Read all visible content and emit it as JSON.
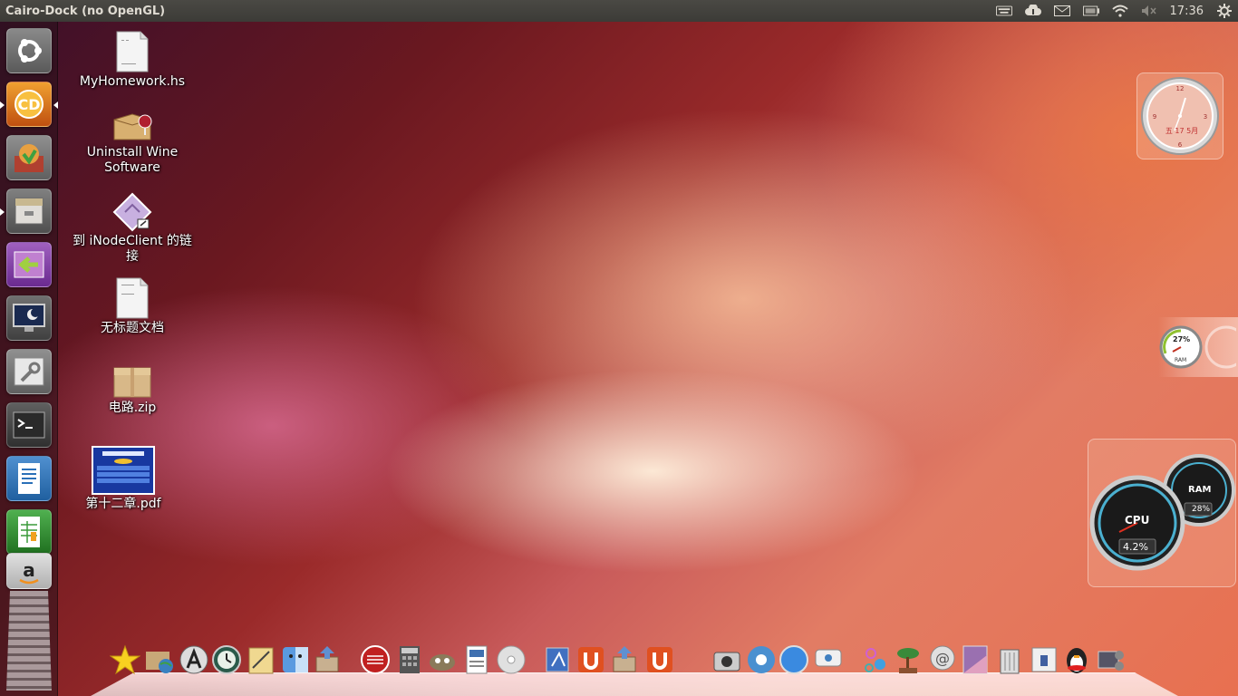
{
  "topbar": {
    "title": "Cairo-Dock (no OpenGL)",
    "time": "17:36",
    "indicators": [
      "keyboard-icon",
      "cloud-icon",
      "mail-icon",
      "battery-icon",
      "wifi-icon",
      "volume-muted-icon",
      "gear-icon"
    ]
  },
  "launcher": {
    "items": [
      {
        "name": "ubuntu-dash",
        "icon": "ubuntu-logo-icon"
      },
      {
        "name": "cairo-dock",
        "icon": "cairo-dock-icon"
      },
      {
        "name": "update-manager",
        "icon": "update-manager-icon"
      },
      {
        "name": "file-manager",
        "icon": "file-cabinet-icon"
      },
      {
        "name": "workspace-switcher",
        "icon": "switch-arrow-icon"
      },
      {
        "name": "screensaver",
        "icon": "monitor-moon-icon"
      },
      {
        "name": "system-settings",
        "icon": "wrench-icon"
      },
      {
        "name": "terminal",
        "icon": "terminal-icon"
      },
      {
        "name": "libreoffice-writer",
        "icon": "writer-icon"
      },
      {
        "name": "libreoffice-calc",
        "icon": "calc-icon"
      },
      {
        "name": "amazon",
        "icon": "amazon-icon"
      }
    ]
  },
  "desktop": {
    "icons": [
      {
        "label": "MyHomework.hs",
        "type": "text-file-icon"
      },
      {
        "label": "Uninstall Wine Software",
        "type": "wine-box-icon"
      },
      {
        "label": "到 iNodeClient 的链接",
        "type": "link-diamond-icon"
      },
      {
        "label": "无标题文档",
        "type": "text-file-icon"
      },
      {
        "label": "电路.zip",
        "type": "zip-box-icon"
      },
      {
        "label": "第十二章.pdf",
        "type": "pdf-thumbnail-icon"
      }
    ]
  },
  "widgets": {
    "clock_label": "五 17 5月",
    "ram_small": "27%",
    "ram_small_label": "RAM",
    "cpu_label": "CPU",
    "cpu_value": "4.2%",
    "ram_label": "RAM",
    "ram_value": "28%"
  },
  "dock": {
    "items": [
      "star-icon",
      "globe-folder-icon",
      "accessories-icon",
      "timemachine-icon",
      "notes-icon",
      "finder-icon",
      "install-box-icon",
      "red-media-icon",
      "calculator-icon",
      "gimp-icon",
      "document-icon",
      "disc-icon",
      "preview-icon",
      "ubuntu-one-icon",
      "install-box-icon",
      "ubuntu-one-icon",
      "camera-icon",
      "chrome-icon",
      "safari-icon",
      "chat-icon",
      "bubbles-icon",
      "bonsai-icon",
      "mail-at-icon",
      "wallpaper-icon",
      "trash-icon",
      "finder-small-icon",
      "qq-penguin-icon",
      "video-icon"
    ]
  },
  "colors": {
    "panel": "#3c3b37",
    "accent": "#dd4814"
  }
}
